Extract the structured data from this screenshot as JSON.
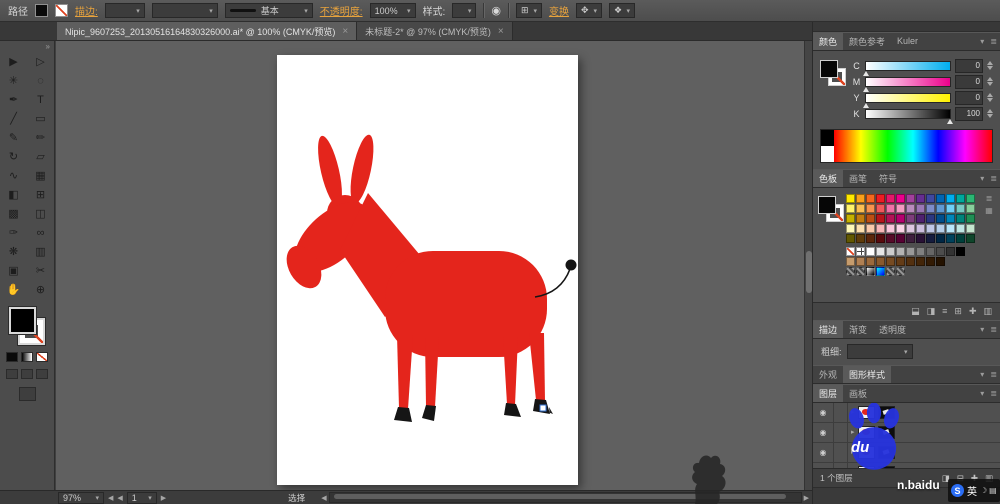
{
  "ui": {
    "collapse_glyph": "▾",
    "menu_glyph": "≣"
  },
  "control_bar": {
    "object_label": "路径",
    "stroke_link": "描边:",
    "brush_value": "基本",
    "opacity_link": "不透明度:",
    "opacity_value": "100%",
    "style_label": "样式:",
    "transform_link": "变换",
    "recolor_glyph": "◉",
    "align_glyph": "⊞",
    "opts1_glyph": "✥",
    "opts2_glyph": "❖"
  },
  "tabs": [
    {
      "title": "Nipic_9607253_20130516164830326000.ai* @ 100% (CMYK/预览)",
      "close": "×",
      "active": true
    },
    {
      "title": "未标题-2* @ 97% (CMYK/预览)",
      "close": "×",
      "active": false
    }
  ],
  "tool_panel": {
    "collapse_glyph": "»"
  },
  "tools": [
    {
      "name": "selection-tool",
      "glyph": "▶"
    },
    {
      "name": "direct-selection-tool",
      "glyph": "▷"
    },
    {
      "name": "magic-wand-tool",
      "glyph": "✳"
    },
    {
      "name": "lasso-tool",
      "glyph": "◌"
    },
    {
      "name": "pen-tool",
      "glyph": "✒"
    },
    {
      "name": "type-tool",
      "glyph": "T"
    },
    {
      "name": "line-segment-tool",
      "glyph": "╱"
    },
    {
      "name": "rectangle-tool",
      "glyph": "▭"
    },
    {
      "name": "paintbrush-tool",
      "glyph": "✎"
    },
    {
      "name": "pencil-tool",
      "glyph": "✏"
    },
    {
      "name": "rotate-tool",
      "glyph": "↻"
    },
    {
      "name": "scale-tool",
      "glyph": "▱"
    },
    {
      "name": "width-tool",
      "glyph": "∿"
    },
    {
      "name": "free-transform-tool",
      "glyph": "▦"
    },
    {
      "name": "shape-builder-tool",
      "glyph": "◧"
    },
    {
      "name": "perspective-grid-tool",
      "glyph": "⊞"
    },
    {
      "name": "mesh-tool",
      "glyph": "▩"
    },
    {
      "name": "gradient-tool",
      "glyph": "◫"
    },
    {
      "name": "eyedropper-tool",
      "glyph": "✑"
    },
    {
      "name": "blend-tool",
      "glyph": "∞"
    },
    {
      "name": "symbol-sprayer-tool",
      "glyph": "❋"
    },
    {
      "name": "graph-tool",
      "glyph": "▥"
    },
    {
      "name": "artboard-tool",
      "glyph": "▣"
    },
    {
      "name": "slice-tool",
      "glyph": "✂"
    },
    {
      "name": "hand-tool",
      "glyph": "✋"
    },
    {
      "name": "zoom-tool",
      "glyph": "⊕"
    }
  ],
  "color_panel": {
    "tabs": [
      {
        "label": "颜色",
        "name": "tab-color"
      },
      {
        "label": "颜色参考",
        "name": "tab-color-guide"
      },
      {
        "label": "Kuler",
        "name": "tab-kuler"
      }
    ],
    "active": 0,
    "sliders": [
      {
        "label": "C",
        "value": "0",
        "pos": 0,
        "color": "#00aeef"
      },
      {
        "label": "M",
        "value": "0",
        "pos": 0,
        "color": "#ec008c"
      },
      {
        "label": "Y",
        "value": "0",
        "pos": 0,
        "color": "#fff200"
      },
      {
        "label": "K",
        "value": "100",
        "pos": 100,
        "color": "#000000"
      }
    ]
  },
  "swatches_panel": {
    "tabs": [
      {
        "label": "色板",
        "name": "tab-swatches"
      },
      {
        "label": "画笔",
        "name": "tab-brushes"
      },
      {
        "label": "符号",
        "name": "tab-symbols"
      }
    ],
    "active": 0,
    "color_rows": [
      [
        "#ffe800",
        "#f9a01b",
        "#f4671e",
        "#ed1c24",
        "#e5186a",
        "#ec008c",
        "#a2409c",
        "#662d91",
        "#3f48a0",
        "#0066b3",
        "#00aeef",
        "#00a99d",
        "#2bb673"
      ],
      [
        "#fff36b",
        "#fbbf54",
        "#f7934f",
        "#f1585c",
        "#f170a8",
        "#f49ac1",
        "#b98bbd",
        "#9a77b5",
        "#7d8cc8",
        "#5f9ad3",
        "#6fd0f7",
        "#77cbc4",
        "#89cf9d"
      ],
      [
        "#c5b100",
        "#c27c10",
        "#bd4f14",
        "#b8141b",
        "#b31256",
        "#b6006f",
        "#7e3d7c",
        "#4f2170",
        "#2b3780",
        "#004f8c",
        "#0087ba",
        "#00837a",
        "#1f8f55"
      ],
      [
        "#fff9b8",
        "#fddfae",
        "#fac9ab",
        "#f8b6b8",
        "#f9c6dc",
        "#fad4e7",
        "#dcc7df",
        "#ccbede",
        "#bfc7e5",
        "#b6cfe9",
        "#bae7fa",
        "#c0e6e3",
        "#c6e6cf"
      ],
      [
        "#625800",
        "#5f3c0a",
        "#5c260b",
        "#590a0d",
        "#570a29",
        "#580034",
        "#3e1e3d",
        "#291136",
        "#151c3e",
        "#002745",
        "#00425c",
        "#00413c",
        "#0f462b"
      ]
    ],
    "gray_row": [
      "#ffffff",
      "#e6e6e6",
      "#cccccc",
      "#b3b3b3",
      "#999999",
      "#808080",
      "#666666",
      "#4d4d4d",
      "#333333",
      "#000000"
    ],
    "earth_row": [
      "#c69c6d",
      "#b08053",
      "#9c6a3c",
      "#8a5a2e",
      "#774b22",
      "#643c17",
      "#53300f",
      "#432508",
      "#331b04",
      "#241200"
    ],
    "texture_row": [
      "pattern",
      "pattern",
      "grad-bw",
      "grad-color",
      "pattern",
      "pattern"
    ],
    "view_icons": [
      {
        "name": "list-view-icon",
        "glyph": "≣"
      },
      {
        "name": "thumbnail-view-icon",
        "glyph": "▦"
      }
    ],
    "footer_icons": [
      {
        "name": "swatch-libraries-icon",
        "glyph": "⬓"
      },
      {
        "name": "swatch-kinds-icon",
        "glyph": "◨"
      },
      {
        "name": "swatch-options-icon",
        "glyph": "≡"
      },
      {
        "name": "new-color-group-icon",
        "glyph": "⊞"
      },
      {
        "name": "new-swatch-icon",
        "glyph": "✚"
      },
      {
        "name": "delete-swatch-icon",
        "glyph": "▥"
      }
    ]
  },
  "stroke_panel": {
    "tabs": [
      {
        "label": "描边",
        "name": "tab-stroke"
      },
      {
        "label": "渐变",
        "name": "tab-gradient"
      },
      {
        "label": "透明度",
        "name": "tab-transparency"
      }
    ],
    "active": 0,
    "weight_label": "粗细:",
    "weight_value": ""
  },
  "appearance_panel": {
    "tabs": [
      {
        "label": "外观",
        "name": "tab-appearance"
      },
      {
        "label": "图形样式",
        "name": "tab-graphic-styles"
      }
    ],
    "active": 1
  },
  "layers_panel": {
    "tabs": [
      {
        "label": "图层",
        "name": "tab-layers"
      },
      {
        "label": "画板",
        "name": "tab-artboards"
      }
    ],
    "active": 0,
    "row_count": 4,
    "eye_glyph": "◉",
    "chevron_glyph": "▸",
    "footer_label": "1 个图层",
    "footer_icons": [
      {
        "name": "make-clipping-mask-icon",
        "glyph": "◨"
      },
      {
        "name": "new-sublayer-icon",
        "glyph": "⊟"
      },
      {
        "name": "new-layer-icon",
        "glyph": "✚"
      },
      {
        "name": "delete-layer-icon",
        "glyph": "▥"
      }
    ]
  },
  "status_bar": {
    "zoom_value": "97%",
    "artboard_value": "1",
    "mode_label": "选择",
    "prev_glyph": "◀",
    "next_glyph": "▶"
  },
  "artwork": {
    "body_color": "#e4251c",
    "hoof_color": "#151515"
  },
  "watermark": {
    "du_text": "du",
    "domain_text": "n.baidu"
  },
  "ime": {
    "logo": "S",
    "lang": "英",
    "icons": [
      {
        "name": "moon-icon",
        "glyph": "☽"
      },
      {
        "name": "keyboard-icon",
        "glyph": "▤"
      }
    ]
  }
}
